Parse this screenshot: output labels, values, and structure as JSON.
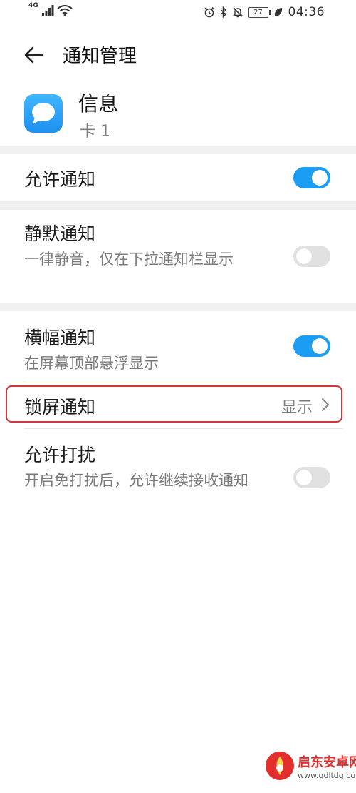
{
  "status_bar": {
    "network_label": "4G",
    "time": "04:36",
    "battery_level": "27",
    "icons": [
      "signal-icon",
      "wifi-icon",
      "alarm-icon",
      "bluetooth-icon",
      "mute-icon",
      "battery-icon",
      "leaf-icon"
    ]
  },
  "header": {
    "title": "通知管理",
    "back_icon": "arrow-left-icon"
  },
  "app_info": {
    "name": "信息",
    "subtitle": "卡 1",
    "icon": "message-bubble-icon",
    "icon_color": "#1e90f0"
  },
  "settings": {
    "allow_notifications": {
      "title": "允许通知",
      "enabled": true
    },
    "silent_notifications": {
      "title": "静默通知",
      "description": "一律静音，仅在下拉通知栏显示",
      "enabled": false
    },
    "banner_notifications": {
      "title": "横幅通知",
      "description": "在屏幕顶部悬浮显示",
      "enabled": true
    },
    "lock_screen_notifications": {
      "title": "锁屏通知",
      "value": "显示",
      "highlight_color": "#d2343a"
    },
    "allow_interruptions": {
      "title": "允许打扰",
      "description": "开启免打扰后，允许继续接收通知",
      "enabled": false
    }
  },
  "colors": {
    "toggle_on": "#1a9df3",
    "toggle_off": "#e1e1e1"
  },
  "watermark": {
    "title": "启东安卓网",
    "url": "www.qdltdg.com"
  }
}
